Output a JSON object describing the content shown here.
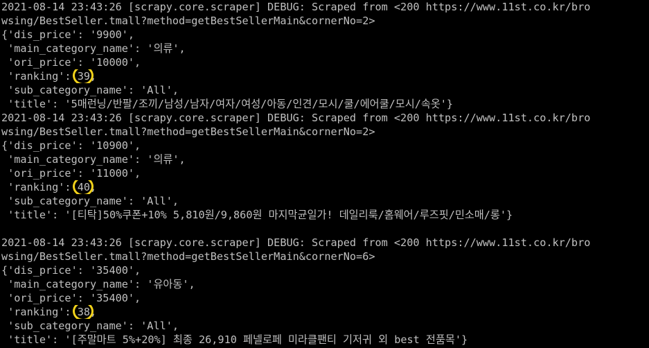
{
  "terminal": {
    "lines": [
      {
        "text": "2021-08-14 23:43:26 [scrapy.core.scraper] DEBUG: Scraped from <200 https://www.11st.co.kr/bro"
      },
      {
        "text": "wsing/BestSeller.tmall?method=getBestSellerMain&cornerNo=2>"
      },
      {
        "text": "{'dis_price': '9900',"
      },
      {
        "text": " 'main_category_name': '의류',"
      },
      {
        "text": " 'ori_price': '10000',"
      },
      {
        "pre": " 'ranking': ",
        "value": "39",
        "post": ","
      },
      {
        "text": " 'sub_category_name': 'All',"
      },
      {
        "text": " 'title': '5매런닝/반팔/조끼/남성/남자/여자/여성/아동/인견/모시/쿨/에어쿨/모시/속옷'}"
      },
      {
        "text": "2021-08-14 23:43:26 [scrapy.core.scraper] DEBUG: Scraped from <200 https://www.11st.co.kr/bro"
      },
      {
        "text": "wsing/BestSeller.tmall?method=getBestSellerMain&cornerNo=2>"
      },
      {
        "text": "{'dis_price': '10900',"
      },
      {
        "text": " 'main_category_name': '의류',"
      },
      {
        "text": " 'ori_price': '11000',"
      },
      {
        "pre": " 'ranking': ",
        "value": "40",
        "post": ","
      },
      {
        "text": " 'sub_category_name': 'All',"
      },
      {
        "text": " 'title': '[티탁]50%쿠폰+10% 5,810원/9,860원 마지막균일가! 데일리룩/홈웨어/루즈핏/민소매/롱'}"
      },
      {
        "text": ""
      },
      {
        "text": "2021-08-14 23:43:26 [scrapy.core.scraper] DEBUG: Scraped from <200 https://www.11st.co.kr/bro"
      },
      {
        "text": "wsing/BestSeller.tmall?method=getBestSellerMain&cornerNo=6>"
      },
      {
        "text": "{'dis_price': '35400',"
      },
      {
        "text": " 'main_category_name': '유아동',"
      },
      {
        "text": " 'ori_price': '35400',"
      },
      {
        "pre": " 'ranking': ",
        "value": "38",
        "post": ","
      },
      {
        "text": " 'sub_category_name': 'All',"
      },
      {
        "text": " 'title': '[주말마트 5%+20%] 최종 26,910 페넬로페 미라클팬티 기저귀 외 best 전품목'}"
      }
    ]
  },
  "colors": {
    "background": "#000000",
    "text": "#c0c0c0",
    "annotation": "#f2d21a"
  }
}
